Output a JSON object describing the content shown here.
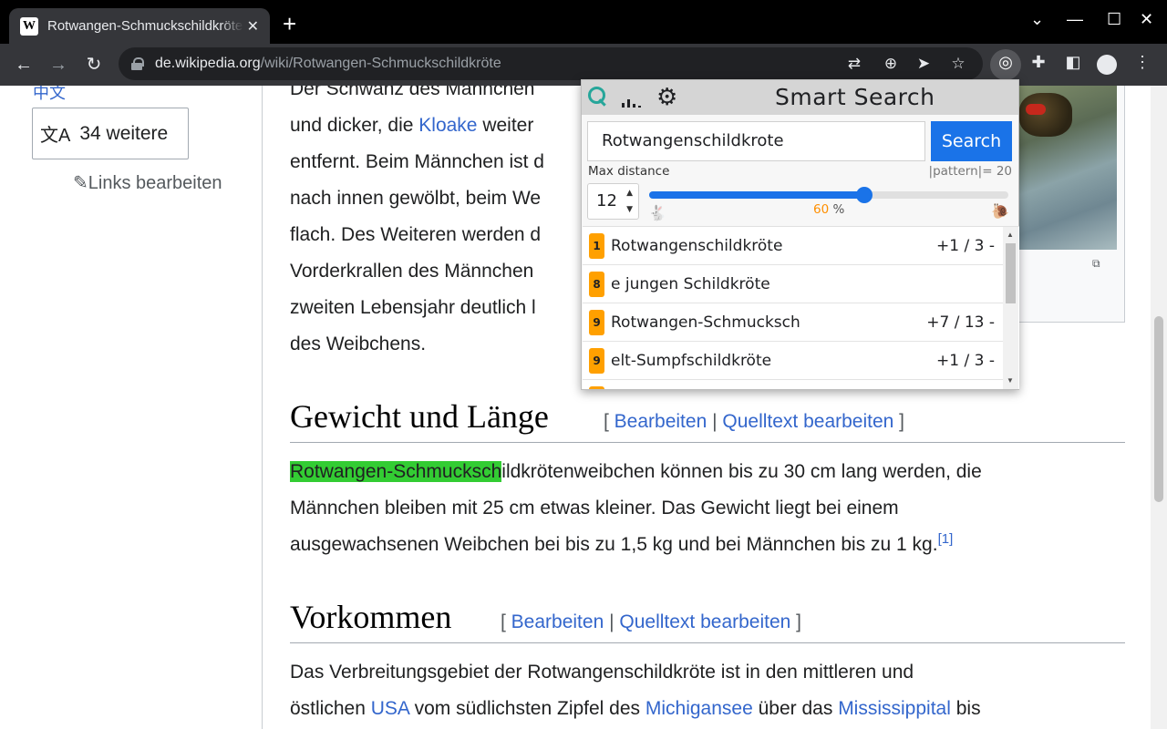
{
  "browser": {
    "tab_title": "Rotwangen-Schmuckschildkröte",
    "tab_close": "✕",
    "new_tab": "+",
    "url_domain": "de.wikipedia.org",
    "url_path": "/wiki/Rotwangen-Schmuckschildkröte",
    "icons": [
      "back-icon",
      "forward-icon",
      "reload-icon",
      "lock-icon",
      "translate-icon",
      "zoom-icon",
      "send-icon",
      "star-icon",
      "smart-search-extension-icon",
      "extensions-icon",
      "side-panel-icon",
      "profile-icon",
      "menu-icon"
    ]
  },
  "sidebar": {
    "lang_fragment": "中文",
    "more_languages": "34 weitere",
    "edit_links": "Links bearbeiten"
  },
  "article": {
    "para1": [
      "Der Schwanz des Männchen",
      "und dicker, die ",
      "Kloake",
      " weiter",
      "entfernt. Beim Männchen ist d",
      "nach innen gewölbt, beim We",
      "flach. Des Weiteren werden d",
      "Vorderkrallen des Männchen",
      "zweiten Lebensjahr deutlich l",
      "des Weibchens."
    ],
    "section1": {
      "title": "Gewicht und Länge",
      "open": "[ ",
      "edit": "Bearbeiten",
      "sep": " | ",
      "source": "Quelltext bearbeiten",
      "close": " ]"
    },
    "para2": {
      "highlight": "Rotwangen-Schmucksch",
      "line1_rest": "ildkrötenweibchen können bis zu 30 cm lang werden, die",
      "line2": "Männchen bleiben mit 25 cm etwas kleiner. Das Gewicht liegt bei einem",
      "line3": "ausgewachsenen Weibchen bei bis zu 1,5 kg und bei Männchen bis zu 1 kg.",
      "ref": "[1]"
    },
    "section2": {
      "title": "Vorkommen",
      "open": "[ ",
      "edit": "Bearbeiten",
      "sep": " | ",
      "source": "Quelltext bearbeiten",
      "close": " ]"
    },
    "para3": {
      "line1": "Das Verbreitungsgebiet der Rotwangenschildkröte ist in den mittleren und",
      "l2_a": "östlichen ",
      "l2_usa": "USA",
      "l2_b": " vom südlichsten Zipfel des ",
      "l2_mich": "Michigansee",
      "l2_c": " über das ",
      "l2_miss": "Mississippital",
      "l2_d": " bis"
    }
  },
  "popup": {
    "title": "Smart Search",
    "search_value": "Rotwangenschildkrote",
    "search_button": "Search",
    "max_distance_label": "Max distance",
    "pattern_label": "|pattern|= 20",
    "distance_value": "12",
    "slider_percent": 60,
    "percent_text": "60",
    "percent_unit": " %",
    "results": [
      {
        "rank": "1",
        "text": "Rotwangenschildkröte",
        "meta": "+1 / 3 -"
      },
      {
        "rank": "8",
        "text": "e jungen Schildkröte",
        "meta": ""
      },
      {
        "rank": "9",
        "text": "Rotwangen-Schmucksch",
        "meta": "+7 / 13 -"
      },
      {
        "rank": "9",
        "text": "elt-Sumpfschildkröte",
        "meta": "+1 / 3 -"
      }
    ]
  },
  "colors": {
    "accent": "#1a73e8",
    "highlight": "#33cc33",
    "badge": "#ffa000",
    "link": "#3366cc"
  }
}
